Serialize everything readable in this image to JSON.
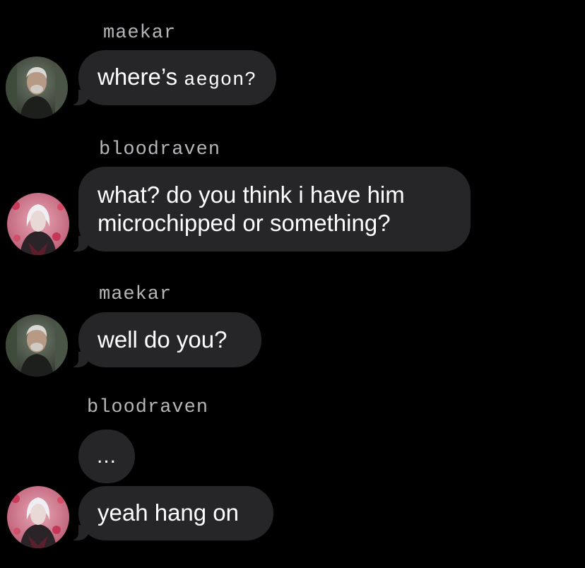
{
  "conversation": {
    "messages": [
      {
        "sender": "maekar",
        "text_prefix": "where’s ",
        "text_mono": "aegon?",
        "has_avatar": true
      },
      {
        "sender": "bloodraven",
        "text": "what? do you think i have him microchipped or something?",
        "has_avatar": true
      },
      {
        "sender": "maekar",
        "text": "well do you?",
        "has_avatar": true
      },
      {
        "sender": "bloodraven",
        "text": "...",
        "has_avatar": false
      },
      {
        "sender": "",
        "text": "yeah hang on",
        "has_avatar": true
      }
    ]
  },
  "avatars": {
    "maekar": "grey-haired-man-portrait",
    "bloodraven": "white-haired-figure-portrait"
  },
  "colors": {
    "background": "#000000",
    "bubble": "#262629",
    "bubble_text": "#ffffff",
    "sender_text": "#b5b5ba"
  }
}
